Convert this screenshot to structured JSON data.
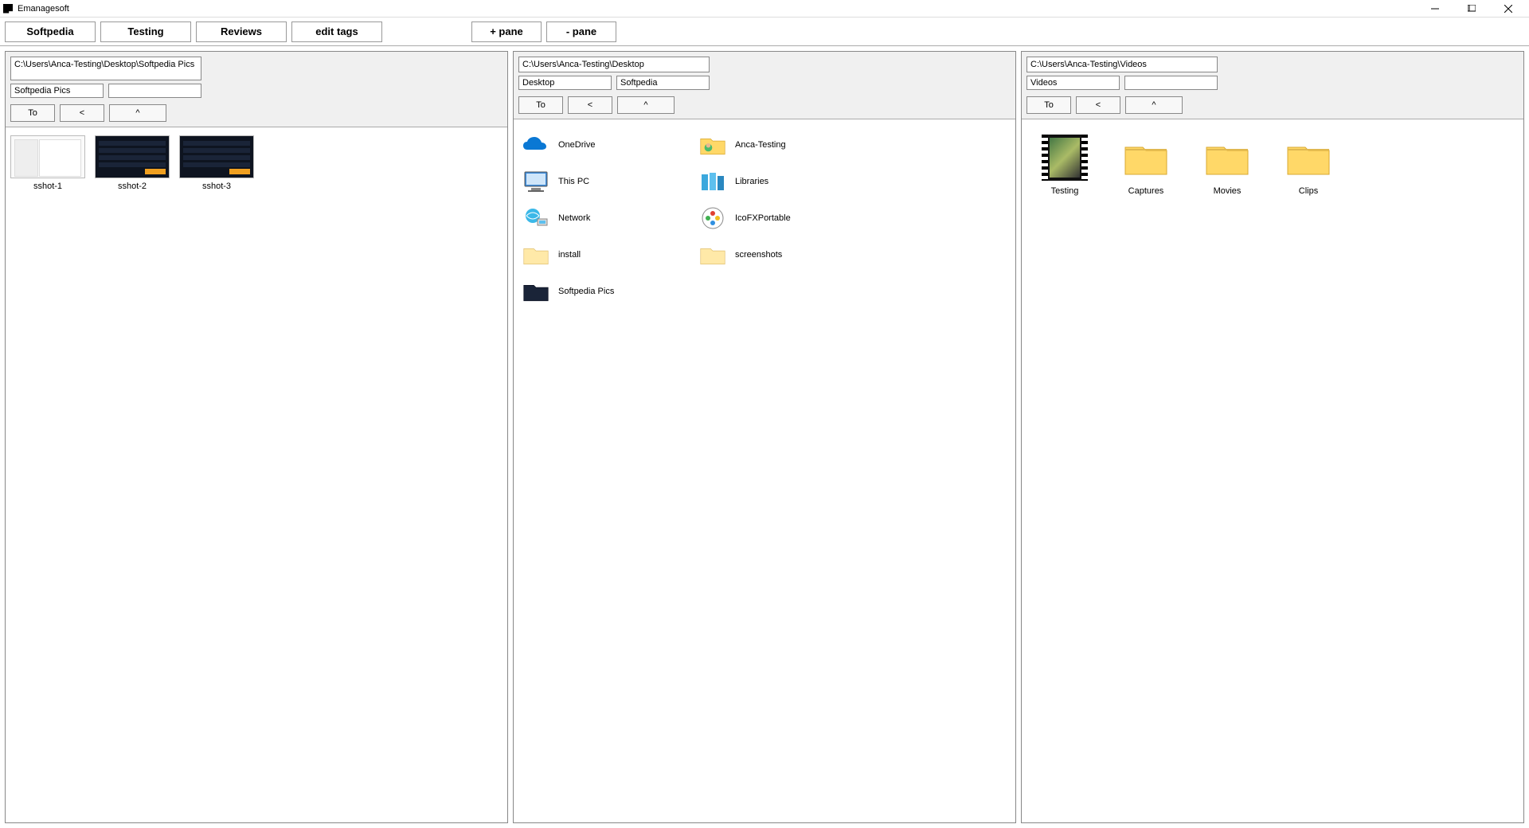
{
  "app_title": "Emanagesoft",
  "toolbar": {
    "tabs": [
      "Softpedia",
      "Testing",
      "Reviews",
      "edit tags"
    ],
    "add_pane": "+ pane",
    "remove_pane": "- pane"
  },
  "panes": [
    {
      "path": "C:\\Users\\Anca-Testing\\Desktop\\Softpedia Pics",
      "field1": "Softpedia Pics",
      "field2": "",
      "btn_to": "To",
      "btn_back": "<",
      "btn_up": "^",
      "layout": "thumbnails",
      "items": [
        {
          "label": "sshot-1",
          "icon": "screenshot-light"
        },
        {
          "label": "sshot-2",
          "icon": "screenshot-dark"
        },
        {
          "label": "sshot-3",
          "icon": "screenshot-dark"
        }
      ]
    },
    {
      "path": "C:\\Users\\Anca-Testing\\Desktop",
      "field1": "Desktop",
      "field2": "Softpedia",
      "btn_to": "To",
      "btn_back": "<",
      "btn_up": "^",
      "layout": "list",
      "columns": [
        [
          {
            "label": "OneDrive",
            "icon": "onedrive"
          },
          {
            "label": "This PC",
            "icon": "thispc"
          },
          {
            "label": "Network",
            "icon": "network"
          },
          {
            "label": "install",
            "icon": "folder"
          },
          {
            "label": "Softpedia Pics",
            "icon": "folder-dark"
          }
        ],
        [
          {
            "label": "Anca-Testing",
            "icon": "user-folder"
          },
          {
            "label": "Libraries",
            "icon": "libraries"
          },
          {
            "label": "IcoFXPortable",
            "icon": "icofx"
          },
          {
            "label": "screenshots",
            "icon": "folder"
          }
        ]
      ]
    },
    {
      "path": "C:\\Users\\Anca-Testing\\Videos",
      "field1": "Videos",
      "field2": "",
      "btn_to": "To",
      "btn_back": "<",
      "btn_up": "^",
      "layout": "large-icons",
      "items": [
        {
          "label": "Testing",
          "icon": "movie"
        },
        {
          "label": "Captures",
          "icon": "folder-big"
        },
        {
          "label": "Movies",
          "icon": "folder-big"
        },
        {
          "label": "Clips",
          "icon": "folder-big"
        }
      ]
    }
  ]
}
